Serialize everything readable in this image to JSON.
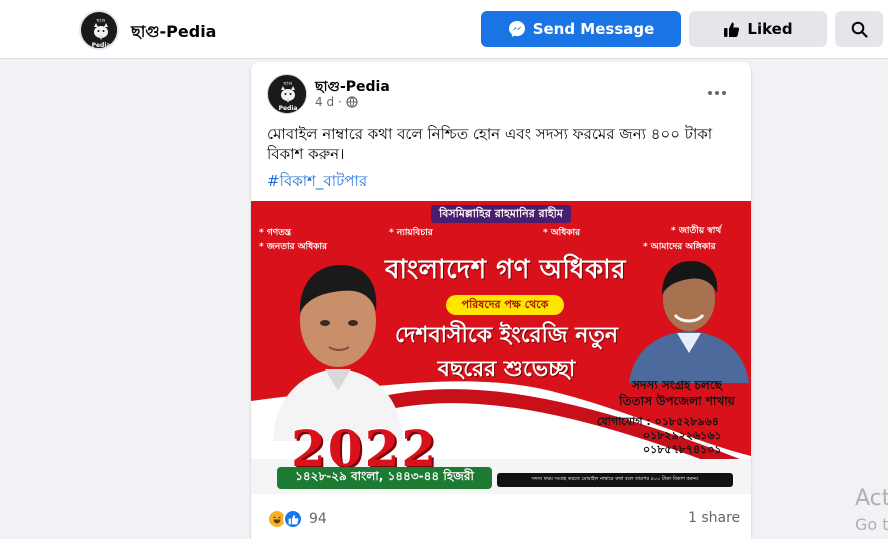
{
  "header": {
    "page_name": "ছাগু-Pedia",
    "logo_top_text": "ছাগু",
    "logo_bottom_text": "Pedia",
    "send_message_label": "Send Message",
    "liked_label": "Liked"
  },
  "post": {
    "author": "ছাগু-Pedia",
    "time": "4 d ·",
    "text": "মোবাইল নাম্বারে কথা বলে নিশ্চিত হোন এবং সদস্য ফরমের জন্য ৪০০ টাকা বিকাশ করুন।",
    "hashtag": "#বিকাশ_বাটপার",
    "reactions_count": "94",
    "shares": "1 share"
  },
  "banner": {
    "top_label": "বিসমিল্লাহির রাহমানির রাহীম",
    "tags": [
      "* গণতন্ত্র",
      "* জনতার অধিকার",
      "* ন্যায়বিচার",
      "* অধিকার",
      "* জাতীয় স্বার্থ",
      "* আমাদের অঙ্গিকার"
    ],
    "title": "বাংলাদেশ গণ অধিকার",
    "subtitle": "পরিষদের পক্ষ থেকে",
    "greeting_line1": "দেশবাসীকে ইংরেজি নতুন",
    "greeting_line2": "বছরের শুভেচ্ছা",
    "year": "2022",
    "member_line1": "সদস্য সংগ্রহ চলছে",
    "member_line2": "তিতাস উপজেলা শাখায়",
    "contact_line1": "যোগাযোগ : ০১৮৫২৮৯৬৪",
    "contact_line2": "০১৮২৯২২৬১৬১",
    "contact_line3": "০১৮৫৭৮৭৪১০১",
    "date_line": "১৪২৮-২৯ বাংলা, ১৪৪৩-৪৪ হিজরী",
    "note": "সদস্য ফরম সংগ্রহ করতে মোবাইল নাম্বারে কথা বলে তারপর ৪০০ টাকা বিকাশ করুন।"
  },
  "watermark": {
    "line1": "Act",
    "line2": "Go t"
  },
  "colors": {
    "brand_blue": "#1b74e4",
    "banner_red": "#d8111a",
    "hashtag_blue": "#216fdb"
  }
}
